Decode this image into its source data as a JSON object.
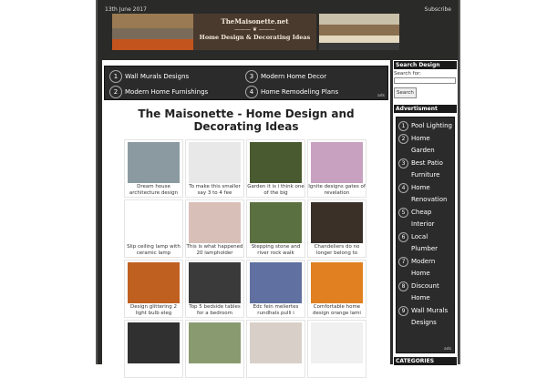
{
  "header": {
    "date": "13th June 2017",
    "subscribe": "Subscribe",
    "site_name": "TheMaisonette.net",
    "tagline": "Home Design & Decorating Ideas"
  },
  "ad_links": [
    {
      "n": "1",
      "label": "Wall Murals Designs"
    },
    {
      "n": "2",
      "label": "Modern Home Furnishings"
    },
    {
      "n": "3",
      "label": "Modern Home Decor"
    },
    {
      "n": "4",
      "label": "Home Remodeling Plans"
    }
  ],
  "ads_label": "ads",
  "page_title": "The Maisonette - Home Design and Decorating Ideas",
  "gallery": [
    {
      "caption": "Dream house architecture design hom",
      "color": "#8a9aa0"
    },
    {
      "caption": "To make this smaller say 3 to 4 fee",
      "color": "#e8e8e8"
    },
    {
      "caption": "Garden it is i think one of the big",
      "color": "#4a5a30"
    },
    {
      "caption": "Ignite designs gates of revelation",
      "color": "#c8a0c0"
    },
    {
      "caption": "Slip ceiling lamp with ceramic lamp",
      "color": "#ffffff"
    },
    {
      "caption": "This is what happened 20 lampholder",
      "color": "#d8c0b8"
    },
    {
      "caption": "Stepping stone and river rock walk",
      "color": "#5a7040"
    },
    {
      "caption": "Chandeliers do no longer belong to",
      "color": "#3a3028"
    },
    {
      "caption": "Design glittering 2 light bulb eleg",
      "color": "#c06020"
    },
    {
      "caption": "Top 5 bedside tables for a bedroom",
      "color": "#3a3a3a"
    },
    {
      "caption": "Edc fein meliertes rundhals pulli i",
      "color": "#6070a0"
    },
    {
      "caption": "Comfortable home design orange lami",
      "color": "#e08020"
    },
    {
      "caption": "",
      "color": "#303030"
    },
    {
      "caption": "",
      "color": "#8a9a70"
    },
    {
      "caption": "",
      "color": "#d8d0c8"
    },
    {
      "caption": "",
      "color": "#f0f0f0"
    }
  ],
  "sidebar": {
    "search_heading": "Search Design",
    "search_label": "Search for:",
    "search_value": "",
    "search_button": "Search",
    "ad_heading": "Advertisment",
    "ads": [
      {
        "n": "1",
        "label": "Pool Lighting"
      },
      {
        "n": "2",
        "label": "Home Garden"
      },
      {
        "n": "3",
        "label": "Best Patio Furniture"
      },
      {
        "n": "4",
        "label": "Home Renovation"
      },
      {
        "n": "5",
        "label": "Cheap Interior"
      },
      {
        "n": "6",
        "label": "Local Plumber"
      },
      {
        "n": "7",
        "label": "Modern Home"
      },
      {
        "n": "8",
        "label": "Discount Home"
      },
      {
        "n": "9",
        "label": "Wall Murals Designs"
      }
    ],
    "categories_heading": "CATEGORIES"
  }
}
